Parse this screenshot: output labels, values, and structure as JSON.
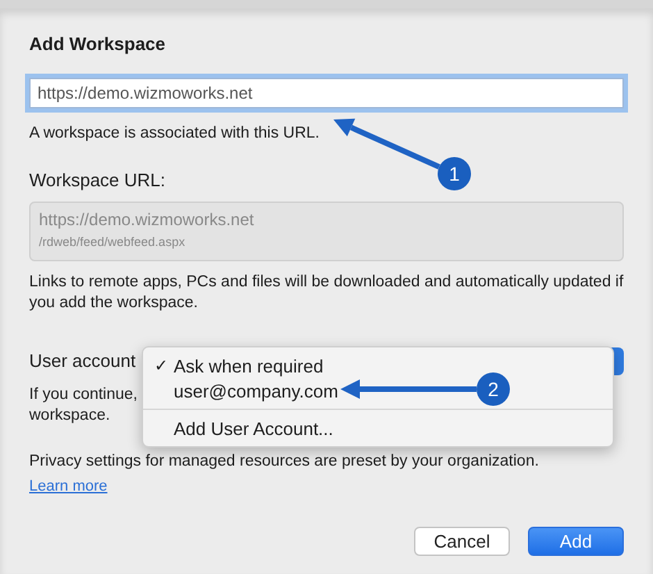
{
  "dialog": {
    "title": "Add Workspace",
    "url_field": {
      "value": "https://demo.wizmoworks.net",
      "focused": true
    },
    "url_hint": "A workspace is associated with this URL.",
    "workspace_url": {
      "label": "Workspace URL:",
      "lines": [
        "https://demo.wizmoworks.net",
        "/rdweb/feed/webfeed.aspx"
      ]
    },
    "links_note": "Links to remote apps, PCs and files will be downloaded and automatically updated if you add the workspace.",
    "user_account": {
      "label": "User account",
      "note_lines": [
        "If you continue,",
        "workspace."
      ]
    },
    "privacy_note": "Privacy settings for managed resources are preset by your organization.",
    "learn_more": "Learn more",
    "buttons": [
      {
        "label": "Cancel",
        "kind": "secondary"
      },
      {
        "label": "Add",
        "kind": "primary"
      }
    ]
  },
  "account_menu": {
    "check_mark": "✓",
    "items": [
      {
        "kind": "option",
        "label": "Ask when required",
        "selected": true
      },
      {
        "kind": "option",
        "label": "user@company.com",
        "selected": false
      },
      {
        "kind": "divider"
      },
      {
        "kind": "action",
        "label": "Add User Account..."
      }
    ]
  },
  "callouts": [
    {
      "number": "1"
    },
    {
      "number": "2"
    }
  ]
}
